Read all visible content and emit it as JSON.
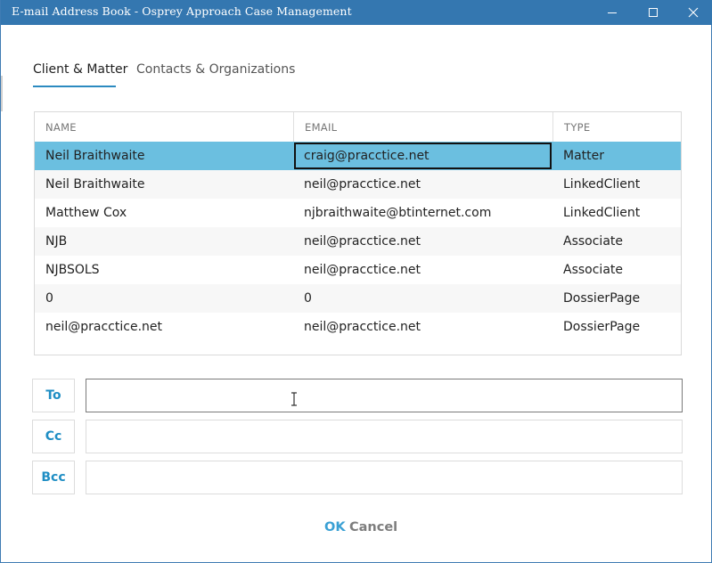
{
  "window": {
    "title": "E-mail Address Book - Osprey Approach Case Management",
    "accent_color": "#3477b0"
  },
  "tabs": [
    {
      "label": "Client & Matter",
      "active": true
    },
    {
      "label": "Contacts & Organizations",
      "active": false
    }
  ],
  "grid": {
    "columns": [
      "NAME",
      "EMAIL",
      "TYPE"
    ],
    "rows": [
      {
        "name": "Neil Braithwaite",
        "email": "craig@pracctice.net",
        "type": "Matter"
      },
      {
        "name": "Neil Braithwaite",
        "email": "neil@pracctice.net",
        "type": "LinkedClient"
      },
      {
        "name": "Matthew Cox",
        "email": "njbraithwaite@btinternet.com",
        "type": "LinkedClient"
      },
      {
        "name": "NJB",
        "email": "neil@pracctice.net",
        "type": "Associate"
      },
      {
        "name": "NJBSOLS",
        "email": "neil@pracctice.net",
        "type": "Associate"
      },
      {
        "name": "0",
        "email": "0",
        "type": "DossierPage"
      },
      {
        "name": "neil@pracctice.net",
        "email": "neil@pracctice.net",
        "type": "DossierPage"
      }
    ],
    "selected_color": "#6bbfe0"
  },
  "recipients": {
    "to_label": "To",
    "to_value": "",
    "cc_label": "Cc",
    "cc_value": "",
    "bcc_label": "Bcc",
    "bcc_value": ""
  },
  "footer": {
    "ok_label": "OK",
    "cancel_label": "Cancel"
  },
  "icons": {
    "minimize": "minimize-icon",
    "maximize": "maximize-icon",
    "close": "close-icon",
    "cursor": "text-cursor-icon"
  }
}
